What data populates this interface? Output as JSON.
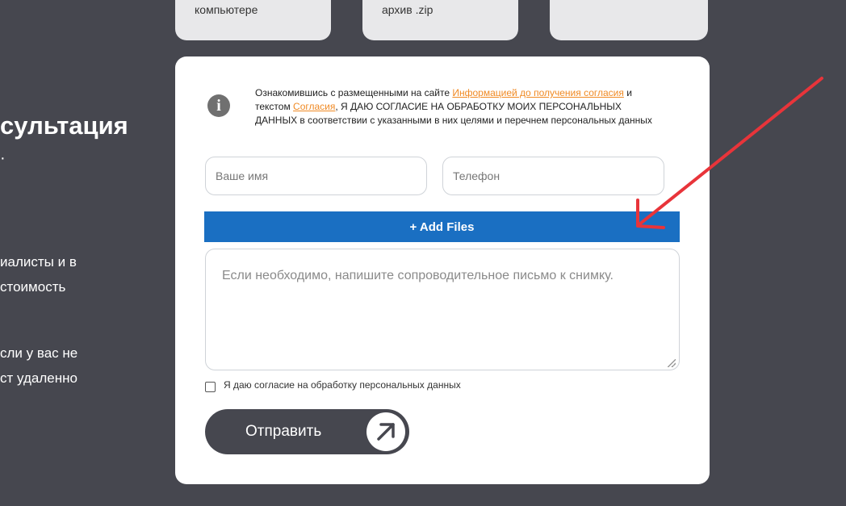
{
  "top_cards": [
    {
      "text": "компьютере"
    },
    {
      "text": "архив .zip"
    },
    {
      "text": ""
    }
  ],
  "left": {
    "heading": "сультация",
    "heading_dot": "·",
    "para1_line1": "иалисты и в",
    "para1_line2": "стоимость",
    "para2_line1": "сли у вас не",
    "para2_line2": "ст удаленно"
  },
  "form": {
    "consent": {
      "part1": "Ознакомившись с размещенными на сайте ",
      "link1": "Информацией до получения согласия",
      "part2": " и текстом ",
      "link2": "Согласия",
      "part3": ", Я ДАЮ СОГЛАСИЕ НА ОБРАБОТКУ МОИХ ПЕРСОНАЛЬНЫХ ДАННЫХ в соответствии с указанными в них целями и перечнем персональных данных"
    },
    "name_placeholder": "Ваше имя",
    "phone_placeholder": "Телефон",
    "add_files_label": "+ Add Files",
    "letter_placeholder": "Если необходимо, напишите сопроводительное письмо к снимку.",
    "checkbox_label": "Я даю согласие на обработку персональных данных",
    "submit_label": "Отправить"
  },
  "colors": {
    "background": "#46474f",
    "accent_button": "#1a6fc2",
    "link": "#f08a24",
    "annotation_arrow": "#e8343a"
  }
}
